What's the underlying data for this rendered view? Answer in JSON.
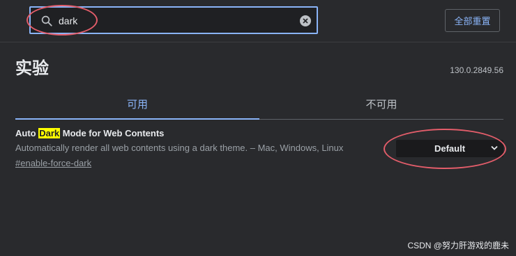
{
  "search": {
    "value": "dark",
    "placeholder": ""
  },
  "header": {
    "reset_label": "全部重置"
  },
  "page": {
    "title": "实验",
    "version": "130.0.2849.56"
  },
  "tabs": [
    {
      "label": "可用",
      "active": true
    },
    {
      "label": "不可用",
      "active": false
    }
  ],
  "feature": {
    "title_prefix": "Auto ",
    "title_highlight": "Dark",
    "title_suffix": " Mode for Web Contents",
    "description": "Automatically render all web contents using a dark theme. – Mac, Windows, Linux",
    "link": "#enable-force-dark",
    "select_value": "Default"
  },
  "watermark": "CSDN @努力肝游戏的鹿未",
  "colors": {
    "accent": "#8ab4f8",
    "highlight": "#ffff00",
    "annotation": "#e35d6a",
    "background": "#292a2d"
  },
  "icons": {
    "search": "search-icon",
    "clear": "clear-icon",
    "dropdown": "chevron-down-icon"
  }
}
